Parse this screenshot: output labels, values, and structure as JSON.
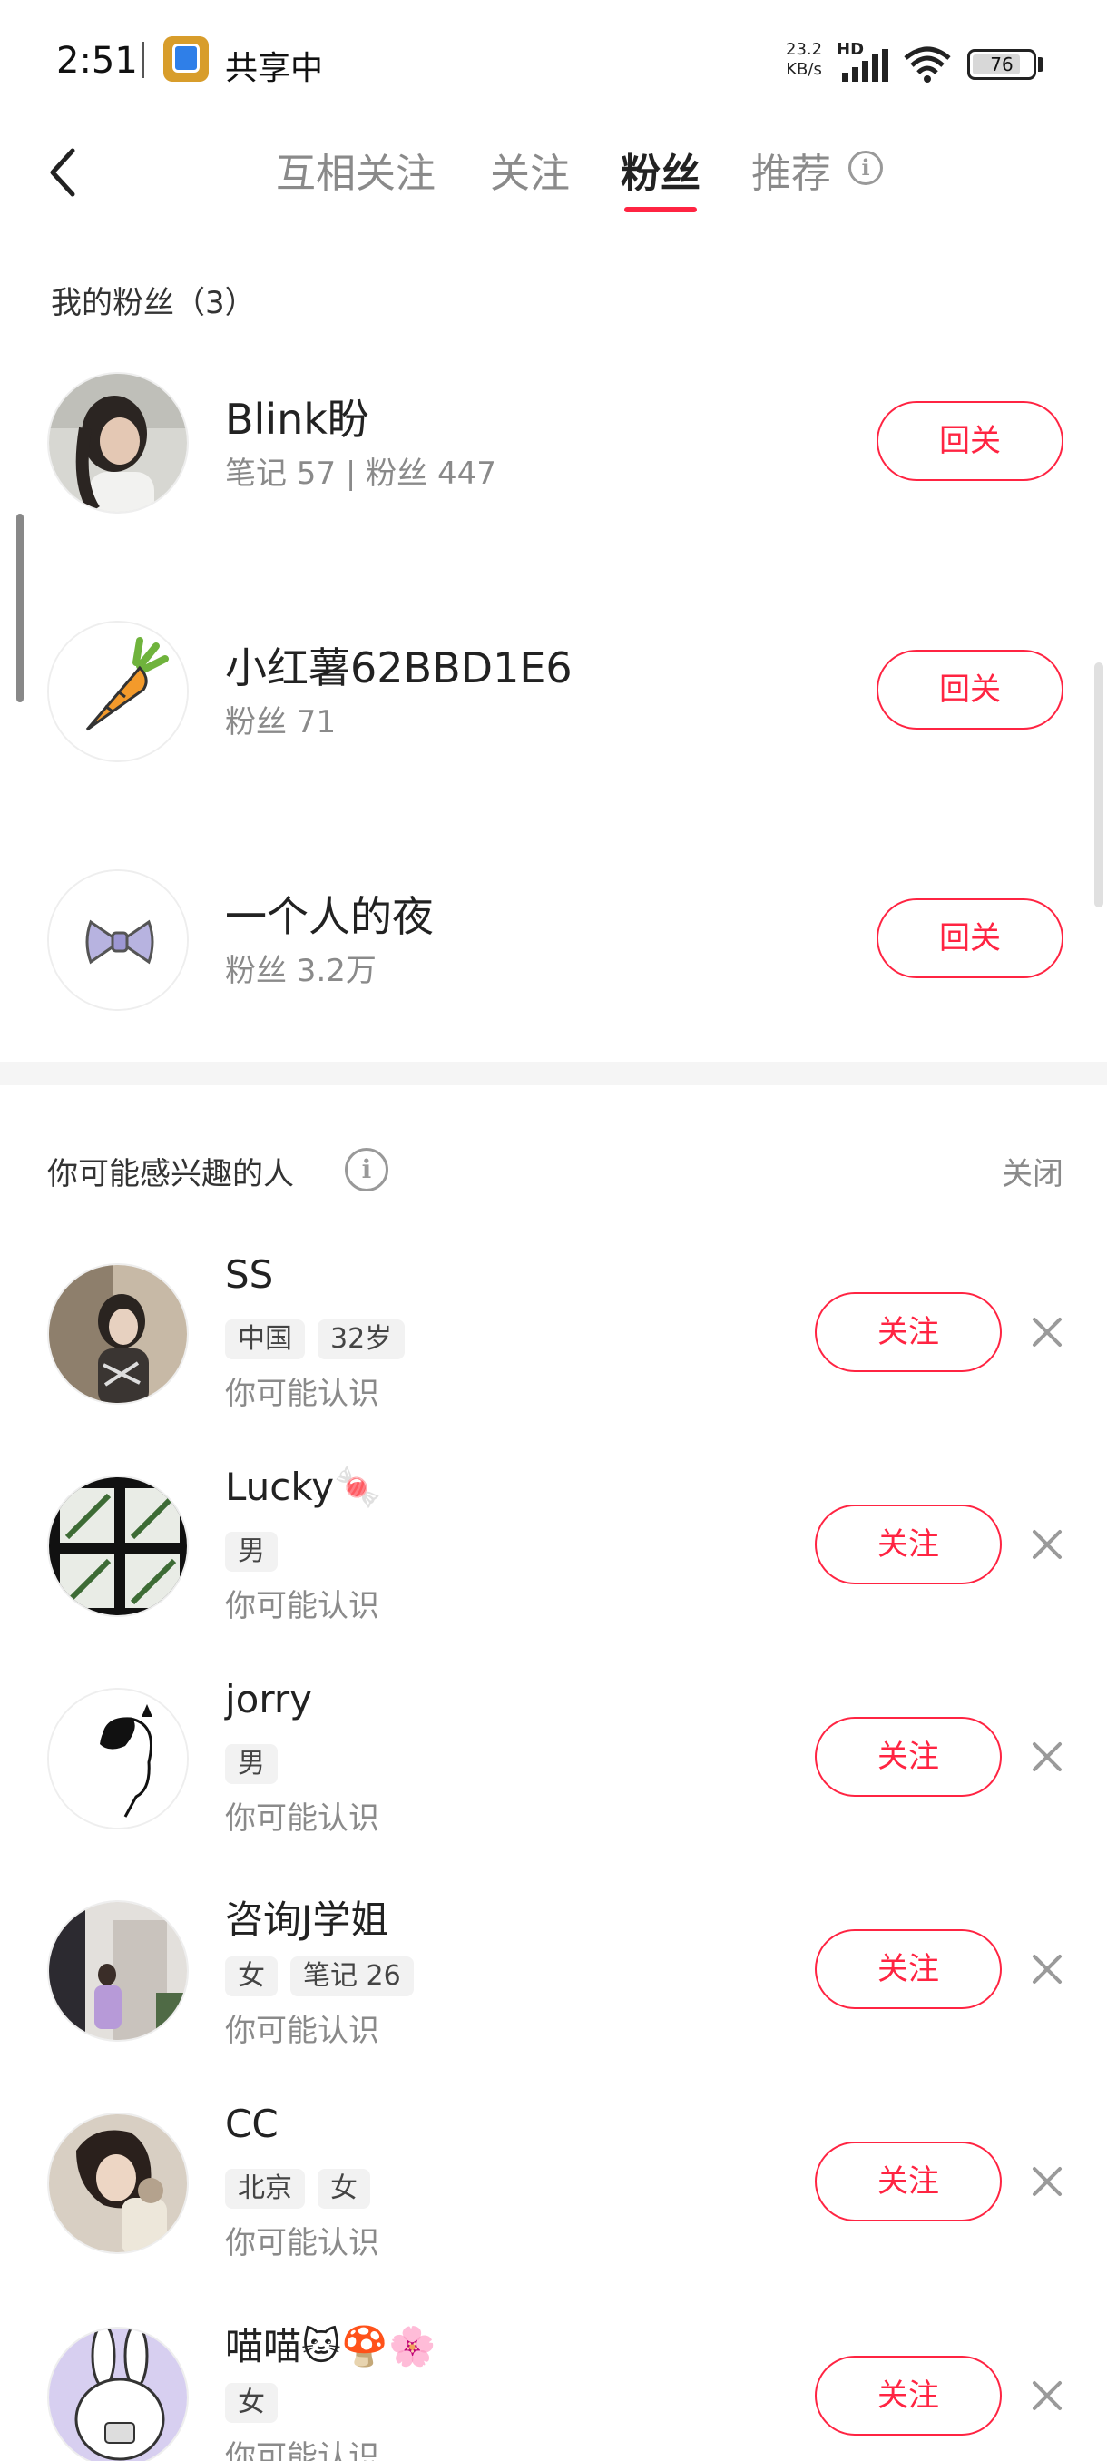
{
  "status_bar": {
    "time": "2:51",
    "share_text": "共享中",
    "net_speed_value": "23.2",
    "net_speed_unit": "KB/s",
    "network": "HD",
    "battery": "76"
  },
  "nav": {
    "tabs": [
      {
        "label": "互相关注"
      },
      {
        "label": "关注"
      },
      {
        "label": "粉丝"
      },
      {
        "label": "推荐"
      }
    ],
    "active_tab": "粉丝",
    "accent_color": "#ff2442"
  },
  "fans": {
    "title": "我的粉丝（3）",
    "button_label": "回关",
    "items": [
      {
        "name": "Blink盼",
        "meta": "笔记 57 | 粉丝 447",
        "avatar": "photo"
      },
      {
        "name": "小红薯62BBD1E6",
        "meta": "粉丝 71",
        "avatar": "carrot-icon"
      },
      {
        "name": "一个人的夜",
        "meta": "粉丝 3.2万",
        "avatar": "bow-icon"
      }
    ]
  },
  "suggestions": {
    "title": "你可能感兴趣的人",
    "close_label": "关闭",
    "button_label": "关注",
    "subtitle": "你可能认识",
    "items": [
      {
        "name": "SS",
        "tags": [
          "中国",
          "32岁"
        ],
        "emoji": ""
      },
      {
        "name": "Lucky",
        "tags": [
          "男"
        ],
        "emoji": "🍬"
      },
      {
        "name": "jorry",
        "tags": [
          "男"
        ],
        "emoji": ""
      },
      {
        "name": "咨询J学姐",
        "tags": [
          "女",
          "笔记 26"
        ],
        "emoji": ""
      },
      {
        "name": "CC",
        "tags": [
          "北京",
          "女"
        ],
        "emoji": ""
      },
      {
        "name": "喵喵",
        "tags": [
          "女"
        ],
        "emoji": "🐱🍄🌸"
      }
    ]
  }
}
